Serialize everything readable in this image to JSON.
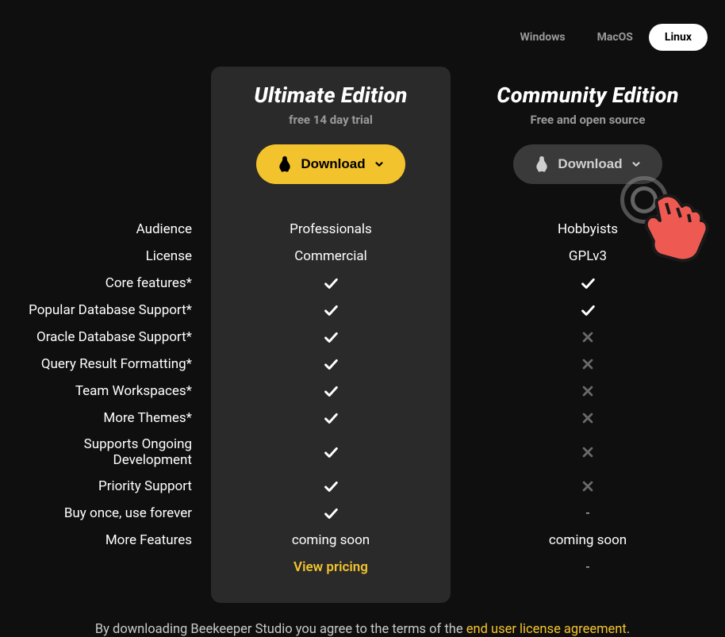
{
  "os_tabs": {
    "windows": "Windows",
    "macos": "MacOS",
    "linux": "Linux"
  },
  "ultimate": {
    "title": "Ultimate Edition",
    "sub": "free 14 day trial",
    "download": "Download"
  },
  "community": {
    "title": "Community Edition",
    "sub": "Free and open source",
    "download": "Download"
  },
  "rows": {
    "audience": {
      "label": "Audience",
      "ult": "Professionals",
      "com": "Hobbyists"
    },
    "license": {
      "label": "License",
      "ult": "Commercial",
      "com": "GPLv3"
    },
    "core": {
      "label": "Core features*"
    },
    "popular": {
      "label": "Popular Database Support*"
    },
    "oracle": {
      "label": "Oracle Database Support*"
    },
    "query": {
      "label": "Query Result Formatting*"
    },
    "team": {
      "label": "Team Workspaces*"
    },
    "themes": {
      "label": "More Themes*"
    },
    "ongoing": {
      "label": "Supports Ongoing Development"
    },
    "priority": {
      "label": "Priority Support"
    },
    "buyonce": {
      "label": "Buy once, use forever",
      "com": "-"
    },
    "more": {
      "label": "More Features",
      "ult": "coming soon",
      "com": "coming soon"
    },
    "pricing": {
      "ult": "View pricing",
      "com": "-"
    }
  },
  "footer": {
    "text": "By downloading Beekeeper Studio you agree to the terms of the ",
    "link": "end user license agreement",
    "period": "."
  }
}
